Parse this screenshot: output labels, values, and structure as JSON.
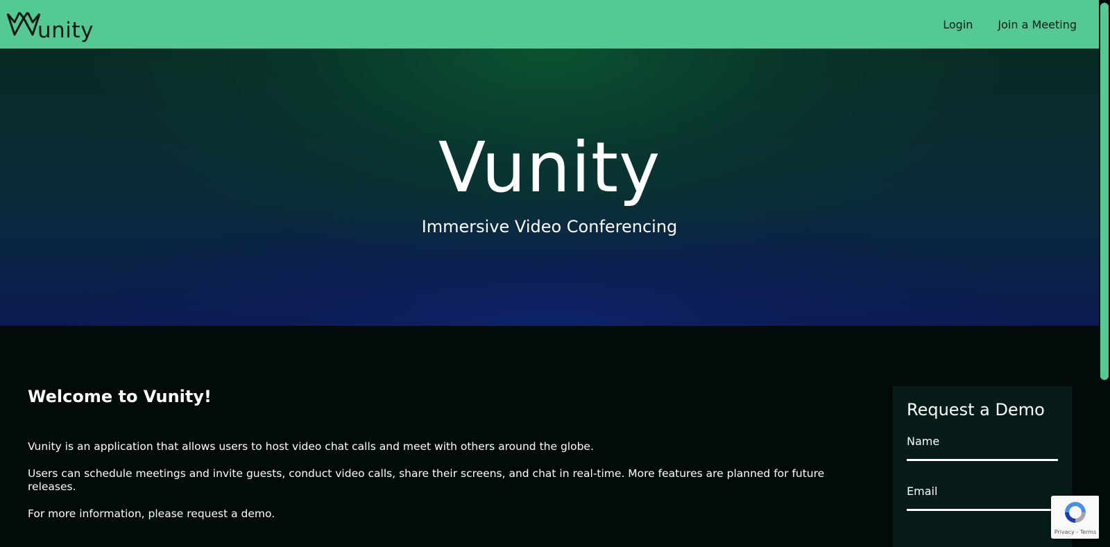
{
  "navbar": {
    "brand": "unity",
    "links": {
      "login": "Login",
      "join": "Join a Meeting"
    }
  },
  "hero": {
    "title": "Vunity",
    "subtitle": "Immersive Video Conferencing"
  },
  "welcome": {
    "title": "Welcome to Vunity!",
    "paragraphs": [
      "Vunity is an application that allows users to host video chat calls and meet with others around the globe.",
      "Users can schedule meetings and invite guests, conduct video calls, share their screens, and chat in real-time. More features are planned for future releases.",
      "For more information, please request a demo."
    ]
  },
  "demo_form": {
    "title": "Request a Demo",
    "name_label": "Name",
    "email_label": "Email"
  },
  "recaptcha": {
    "links": "Privacy - Terms"
  },
  "colors": {
    "navbar": "#55c994",
    "page_background": "#030b0a",
    "demo_card": "#071c18",
    "text_light": "#ffffff",
    "text_dark": "#0c1a15"
  },
  "icons": {
    "brand": "vunity-crown-logo-icon",
    "recaptcha": "recaptcha-logo-icon"
  }
}
